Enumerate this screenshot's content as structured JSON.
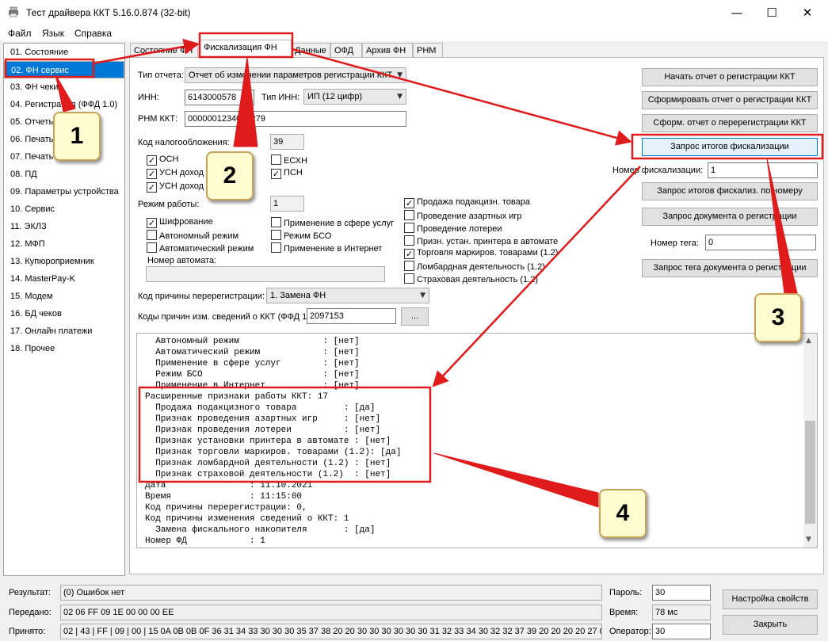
{
  "window": {
    "title": "Тест драйвера ККТ 5.16.0.874 (32-bit)",
    "min": "—",
    "max": "☐",
    "close": "✕"
  },
  "menu": [
    "Файл",
    "Язык",
    "Справка"
  ],
  "sidebar": [
    "01. Состояние",
    "02. ФН сервис",
    "03. ФН чеки",
    "04. Регистрация (ФФД 1.0)",
    "05. Отчеты",
    "06. Печать",
    "07. Печать",
    "08. ПД",
    "09. Параметры устройства",
    "10. Сервис",
    "11. ЭКЛЗ",
    "12. МФП",
    "13. Купюроприемник",
    "14. MasterPay-K",
    "15. Модем",
    "16. БД чеков",
    "17. Онлайн платежи",
    "18. Прочее"
  ],
  "tabs": [
    "Состояние ФН",
    "Фискализация ФН",
    "Данные",
    "ОФД",
    "Архив ФН",
    "РНМ"
  ],
  "form": {
    "report_type_label": "Тип отчета:",
    "report_type_value": "Отчет об изменении параметров регистрации ККТ",
    "inn_label": "ИНН:",
    "inn_value": "6143000578",
    "inn_type_label": "Тип ИНН:",
    "inn_type_value": "ИП (12 цифр)",
    "rnm_label": "РНМ ККТ:",
    "rnm_value": "0000001234012279",
    "tax_label": "Код налогообложения:",
    "tax_value": "39",
    "tax_checks": [
      {
        "label": "ОСН",
        "checked": true
      },
      {
        "label": "ЕСХН",
        "checked": false
      },
      {
        "label": "УСН доход",
        "checked": true
      },
      {
        "label": "ПСН",
        "checked": true
      },
      {
        "label": "УСН доход",
        "checked": true
      }
    ],
    "mode_label": "Режим работы:",
    "mode_value": "1",
    "mode_checks": [
      {
        "label": "Шифрование",
        "checked": true
      },
      {
        "label": "Применение в сфере услуг",
        "checked": false
      },
      {
        "label": "Автономный режим",
        "checked": false
      },
      {
        "label": "Режим БСО",
        "checked": false
      },
      {
        "label": "Автоматический режим",
        "checked": false
      },
      {
        "label": "Применение в Интернет",
        "checked": false
      }
    ],
    "automat_label": "Номер автомата:",
    "ext_checks": [
      {
        "label": "Продажа подакцизн. товара",
        "checked": true
      },
      {
        "label": "Проведение азартных игр",
        "checked": false
      },
      {
        "label": "Проведение лотереи",
        "checked": false
      },
      {
        "label": "Призн. устан. принтера в автомате",
        "checked": false
      },
      {
        "label": "Торговля маркиров. товарами (1.2)",
        "checked": true
      },
      {
        "label": "Ломбардная деятельность (1.2)",
        "checked": false
      },
      {
        "label": "Страховая деятельность (1.2)",
        "checked": false
      }
    ],
    "rereg_label": "Код причины перерегистрации:",
    "rereg_value": "1. Замена ФН",
    "change_codes_label": "Коды причин изм. сведений о ККТ (ФФД 1.1):",
    "change_codes_value": "2097153",
    "change_codes_btn": "..."
  },
  "right": {
    "btn_start": "Начать отчет о регистрации ККТ",
    "btn_make": "Сформировать отчет о регистрации ККТ",
    "btn_rereg": "Сформ. отчет о перерегистрации ККТ",
    "btn_query": "Запрос итогов фискализации",
    "fisc_num_label": "Номер фискализации:",
    "fisc_num_value": "1",
    "btn_query_num": "Запрос итогов фискализ. по номеру",
    "btn_doc": "Запрос документа о регистрации",
    "tag_label": "Номер тега:",
    "tag_value": "0",
    "btn_tag": "Запрос тега документа о регистрации"
  },
  "log": [
    "  Автономный режим                : [нет]",
    "  Автоматический режим            : [нет]",
    "  Применение в сфере услуг        : [нет]",
    "  Режим БСО                       : [нет]",
    "  Применение в Интернет           : [нет]",
    "Расширенные признаки работы ККТ: 17",
    "  Продажа подакцизного товара         : [да]",
    "  Признак проведения азартных игр     : [нет]",
    "  Признак проведения лотереи          : [нет]",
    "  Признак установки принтера в автомате : [нет]",
    "  Признак торговли маркиров. товарами (1.2): [да]",
    "  Признак ломбардной деятельности (1.2) : [нет]",
    "  Признак страховой деятельности (1.2)  : [нет]",
    "Дата                : 11.10.2021",
    "Время               : 11:15:00",
    "Код причины перерегистрации: 0,",
    "Код причины изменения сведений о ККТ: 1",
    "  Замена фискального накопителя       : [да]",
    "Номер ФД            : 1"
  ],
  "bottom": {
    "result_label": "Результат:",
    "result_value": "(0) Ошибок нет",
    "sent_label": "Передано:",
    "sent_value": "02 06 FF 09 1E 00 00 00 EE",
    "recv_label": "Принято:",
    "recv_value": "02 | 43 | FF | 09 | 00 | 15 0A 0B 0B 0F 36 31 34 33 30 30 30 35 37 38 20 20 30 30 30 30 30 30 31 32 33 34 30 32 32 37 39 20 20 20 20 27 0",
    "password_label": "Пароль:",
    "password_value": "30",
    "time_label": "Время:",
    "time_value": "78 мс",
    "operator_label": "Оператор:",
    "operator_value": "30",
    "btn_settings": "Настройка свойств",
    "btn_close": "Закрыть"
  },
  "badges": [
    "1",
    "2",
    "3",
    "4"
  ],
  "colors": {
    "annotation": "#e01b1b",
    "selection": "#0078d7"
  }
}
